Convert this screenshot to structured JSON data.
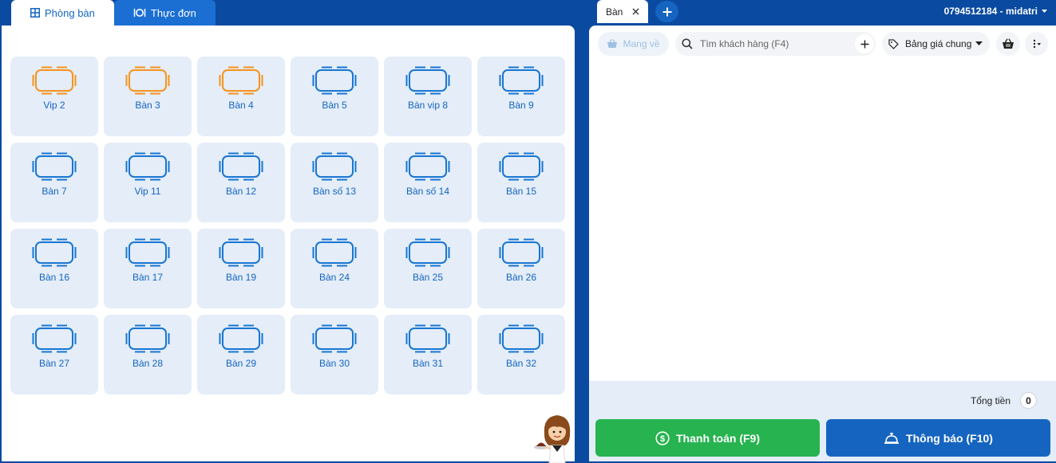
{
  "left_tabs": [
    {
      "label": "Phòng bàn",
      "icon": "grid-icon"
    },
    {
      "label": "Thực đơn",
      "icon": "food-icon"
    }
  ],
  "tables": [
    {
      "name": "Vip 2",
      "status": "occupied"
    },
    {
      "name": "Bàn 3",
      "status": "occupied"
    },
    {
      "name": "Bàn 4",
      "status": "occupied"
    },
    {
      "name": "Bàn 5",
      "status": "empty"
    },
    {
      "name": "Bàn vip 8",
      "status": "empty"
    },
    {
      "name": "Bàn 9",
      "status": "empty"
    },
    {
      "name": "Bàn 7",
      "status": "empty"
    },
    {
      "name": "Vip 11",
      "status": "empty"
    },
    {
      "name": "Bàn 12",
      "status": "empty"
    },
    {
      "name": "Bàn số 13",
      "status": "empty"
    },
    {
      "name": "Bàn số 14",
      "status": "empty"
    },
    {
      "name": "Bàn 15",
      "status": "empty"
    },
    {
      "name": "Bàn 16",
      "status": "empty"
    },
    {
      "name": "Bàn 17",
      "status": "empty"
    },
    {
      "name": "Bàn 19",
      "status": "empty"
    },
    {
      "name": "Bàn 24",
      "status": "empty"
    },
    {
      "name": "Bàn 25",
      "status": "empty"
    },
    {
      "name": "Bàn 26",
      "status": "empty"
    },
    {
      "name": "Bàn 27",
      "status": "empty"
    },
    {
      "name": "Bàn 28",
      "status": "empty"
    },
    {
      "name": "Bàn 29",
      "status": "empty"
    },
    {
      "name": "Bàn 30",
      "status": "empty"
    },
    {
      "name": "Bàn 31",
      "status": "empty"
    },
    {
      "name": "Bàn 32",
      "status": "empty"
    }
  ],
  "order": {
    "tab_label": "Bàn",
    "user": "0794512184 - midatri",
    "takeaway_label": "Mang về",
    "search_placeholder": "Tìm khách hàng (F4)",
    "price_list": "Bảng giá chung",
    "total_label": "Tổng tiền",
    "total_value": "0",
    "pay_label": "Thanh toán (F9)",
    "notify_label": "Thông báo (F10)"
  },
  "colors": {
    "brand": "#0a4aa0",
    "primary": "#1565c0",
    "occupied": "#f7931e",
    "empty": "#1976d2",
    "pay": "#27b34f"
  }
}
